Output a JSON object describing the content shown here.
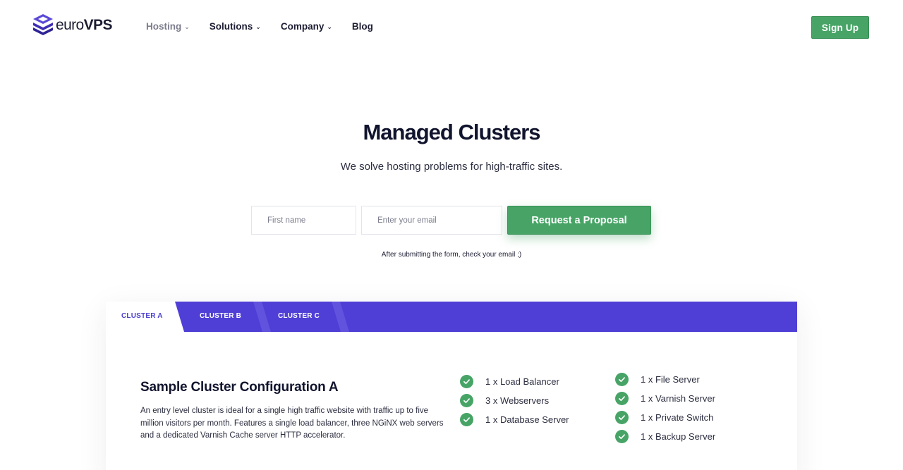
{
  "brand": {
    "logo_prefix": "euro",
    "logo_suffix": "VPS",
    "logo_icon": "stacked-layers-icon"
  },
  "nav": {
    "items": [
      {
        "label": "Hosting",
        "has_dropdown": true,
        "active": false
      },
      {
        "label": "Solutions",
        "has_dropdown": true,
        "active": true
      },
      {
        "label": "Company",
        "has_dropdown": true,
        "active": true
      },
      {
        "label": "Blog",
        "has_dropdown": false,
        "active": true
      }
    ],
    "signup_label": "Sign Up"
  },
  "hero": {
    "title": "Managed Clusters",
    "subtitle": "We solve hosting problems for high-traffic sites."
  },
  "form": {
    "first_name_placeholder": "First name",
    "email_placeholder": "Enter your email",
    "submit_label": "Request a Proposal",
    "note": "After submitting the form, check your email ;)"
  },
  "clusters": {
    "tabs": [
      {
        "label": "CLUSTER A",
        "selected": true
      },
      {
        "label": "CLUSTER B",
        "selected": false
      },
      {
        "label": "CLUSTER C",
        "selected": false
      }
    ],
    "title": "Sample Cluster Configuration A",
    "description": "An entry level cluster is ideal for a single high traffic website with traffic up to five million visitors per month. Features a single load balancer, three NGiNX web servers and a dedicated Varnish Cache server HTTP accelerator.",
    "features_col1": [
      "1 x Load Balancer",
      "3 x Webservers",
      "1 x Database Server"
    ],
    "features_col2": [
      "1 x File Server",
      "1 x Varnish Server",
      "1 x Private Switch",
      "1 x Backup Server"
    ]
  },
  "colors": {
    "accent_green": "#47a466",
    "tab_purple": "#4f3fd6",
    "text_dark": "#11142d",
    "logo_purple": "#4a39c6"
  }
}
